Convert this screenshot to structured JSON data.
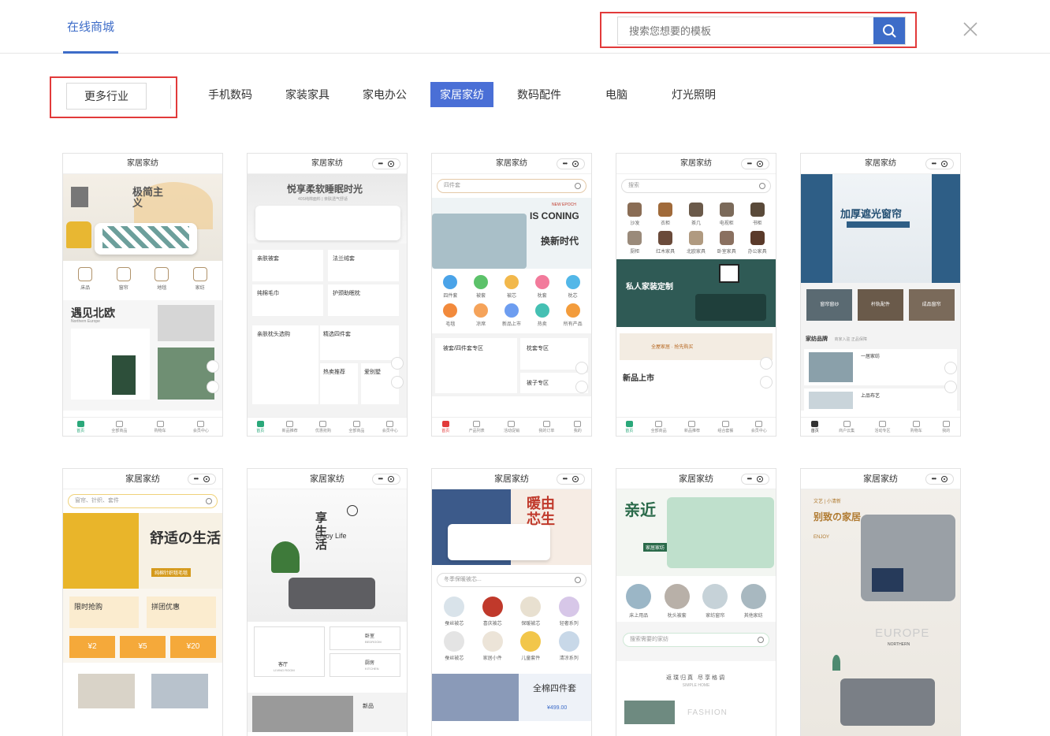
{
  "header": {
    "active_tab": "在线商城",
    "search_placeholder": "搜索您想要的模板",
    "icons": {
      "search": "search-icon",
      "close": "close-icon"
    },
    "accent_color": "#3d6cc8",
    "highlight_color": "#e23a3a"
  },
  "categories": {
    "more_label": "更多行业",
    "items": [
      {
        "label": "手机数码",
        "active": false
      },
      {
        "label": "家装家具",
        "active": false
      },
      {
        "label": "家电办公",
        "active": false
      },
      {
        "label": "家居家纺",
        "active": true
      },
      {
        "label": "数码配件",
        "active": false
      },
      {
        "label": "电脑",
        "active": false
      },
      {
        "label": "灯光照明",
        "active": false
      }
    ]
  },
  "templates": [
    {
      "title": "家居家纺",
      "banner_text": "极简主义",
      "icons": [
        "床品",
        "窗帘",
        "地毯",
        "家纺"
      ],
      "section_title": "遇见北欧",
      "section_sub": "Northern Europe",
      "tabbar": [
        "首页",
        "全部商品",
        "购物车",
        "会员中心"
      ]
    },
    {
      "title": "家居家纺",
      "banner_text": "悦享柔软睡眠时光",
      "banner_sub": "40S纯棉面料 | 亲肤透气舒适",
      "tiles": [
        "亲肤被套",
        "法兰绒套",
        "纯棉毛巾",
        "护颈助眠枕",
        "亲肤枕头选购",
        "精选四件套",
        "热卖推荐",
        "爱别墅"
      ],
      "tabbar": [
        "首页",
        "新品推荐",
        "优惠抢购",
        "全部商品",
        "会员中心"
      ]
    },
    {
      "title": "家居家纺",
      "search_placeholder": "四件套",
      "banner_text_1": "IS CONING",
      "banner_text_2": "换新时代",
      "banner_sub": "NEW EPOCH",
      "icons": [
        "四件套",
        "被套",
        "被芯",
        "枕套",
        "枕芯",
        "毛毯",
        "凉席",
        "新品上市",
        "热卖",
        "所有产品"
      ],
      "tiles": [
        "被套/四件套专区",
        "枕套专区",
        "被子专区"
      ],
      "tabbar": [
        "首页",
        "产品列表",
        "活动促销",
        "我的订单",
        "我的"
      ]
    },
    {
      "title": "家居家纺",
      "search_placeholder": "搜索",
      "icons": [
        "沙发",
        "衣柜",
        "茶几",
        "电视柜",
        "书柜",
        "厨柜",
        "红木家具",
        "北欧家具",
        "卧室家具",
        "办公家具"
      ],
      "banner_text": "私人家装定制",
      "promo": "全屋家居 · 抢先购买",
      "section_title": "新品上市",
      "tabbar": [
        "首页",
        "全部商品",
        "新品推荐",
        "组合套餐",
        "会员中心"
      ]
    },
    {
      "title": "家居家纺",
      "banner_text": "加厚遮光窗帘",
      "tiles": [
        "窗帘窗纱",
        "杆轨配件",
        "成品窗帘"
      ],
      "section_title": "家纺品牌",
      "section_sub": "商家入驻 正品保障",
      "shop_1": "一居家纺",
      "shop_2": "上品布艺",
      "tabbar": [
        "首页",
        "商户云集",
        "活动专区",
        "购物车",
        "我的"
      ]
    },
    {
      "title": "家居家纺",
      "search_placeholder": "窗帘、针织、套件",
      "banner_text": "舒适の生活",
      "banner_sub": "纯棉针织毯毛毯",
      "tiles": [
        "限时抢购",
        "拼团优惠"
      ],
      "coupons": [
        "¥2",
        "¥5",
        "¥20"
      ]
    },
    {
      "title": "家居家纺",
      "banner_text": "享生活",
      "banner_sub": "Enjoy Life",
      "tiles": [
        "客厅",
        "卧室",
        "厨房",
        "新品"
      ],
      "tile_subs": [
        "LIVING ROOM",
        "BEDROOM",
        "KITCHEN"
      ]
    },
    {
      "title": "家居家纺",
      "banner_text": "暖由芯生",
      "search_placeholder": "冬季保暖被芯...",
      "icons": [
        "蚕丝被芯",
        "喜庆被芯",
        "保暖被芯",
        "轻奢系列",
        "蚕丝被芯",
        "家居小件",
        "儿童套件",
        "清凉系列"
      ],
      "promo": "全棉四件套",
      "price": "¥499.00"
    },
    {
      "title": "家居家纺",
      "banner_text": "亲近",
      "banner_sub": "家居家纺",
      "icons": [
        "床上用品",
        "枕头被套",
        "家纺窗帘",
        "其他家纺"
      ],
      "search_placeholder": "搜索需要的家纺",
      "section_title": "返璞归真 尽享格调",
      "section_sub": "SIMPLE HOME",
      "fashion": "FASHION"
    },
    {
      "title": "家居家纺",
      "banner_text": "别致の家居",
      "banner_sub": "ENJOY",
      "label_top": "文艺 | 小清新",
      "europe": "EUROPE",
      "northern": "NORTHERN"
    }
  ]
}
